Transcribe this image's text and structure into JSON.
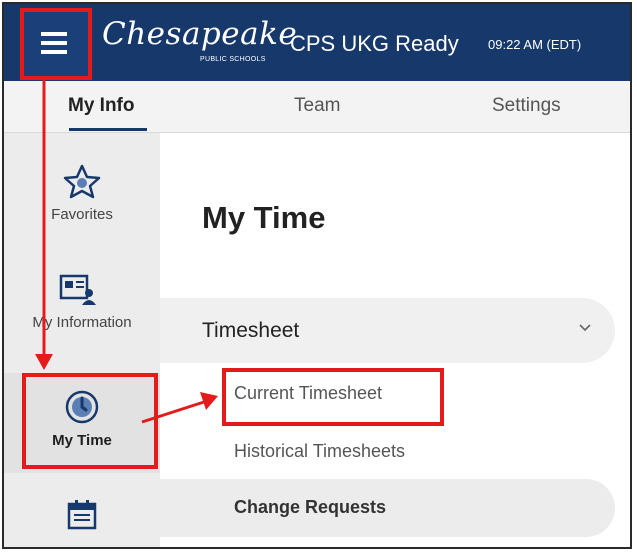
{
  "header": {
    "logo_text": "Chesapeake",
    "logo_subtext": "PUBLIC SCHOOLS",
    "app_title": "CPS UKG Ready",
    "clock": "09:22 AM (EDT)"
  },
  "tabs": [
    {
      "label": "My Info",
      "active": true
    },
    {
      "label": "Team",
      "active": false
    },
    {
      "label": "Settings",
      "active": false
    }
  ],
  "sidebar": {
    "items": [
      {
        "label": "Favorites",
        "icon": "star-icon"
      },
      {
        "label": "My Information",
        "icon": "id-card-icon"
      },
      {
        "label": "My Time",
        "icon": "clock-icon",
        "active": true
      },
      {
        "label": "",
        "icon": "calendar-icon"
      }
    ]
  },
  "main": {
    "page_title": "My Time",
    "section": {
      "label": "Timesheet",
      "expanded": true
    },
    "links": [
      {
        "label": "Current Timesheet"
      },
      {
        "label": "Historical Timesheets"
      },
      {
        "label": "Change Requests"
      }
    ]
  },
  "colors": {
    "header_bg": "#17386b",
    "annotation_red": "#e31b1b",
    "sidebar_bg": "#ececec"
  }
}
